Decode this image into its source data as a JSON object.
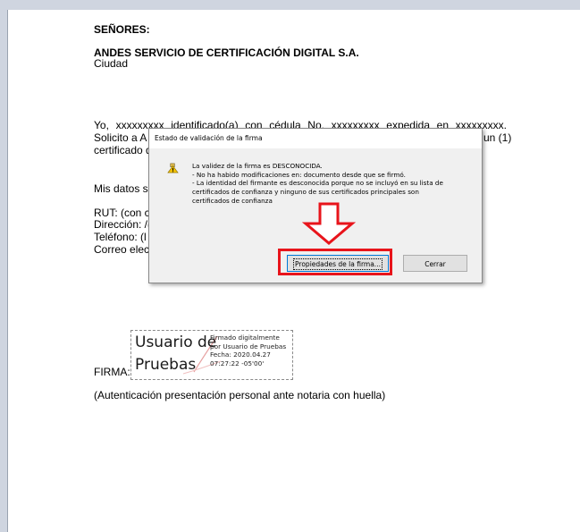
{
  "document": {
    "heading": "SEÑORES:",
    "company": "ANDES SERVICIO DE CERTIFICACIÓN DIGITAL S.A.",
    "city": "Ciudad",
    "p1_line1": "Yo, xxxxxxxxx identificado(a) con cédula No. xxxxxxxxx expedida en xxxxxxxxx.",
    "p1_line2_start": "Solicito a A",
    "p1_line2_end": "un (1)",
    "p1_line3_start": "certificado d",
    "datos_start": "Mis datos s",
    "rut_start": "RUT: (con c",
    "direccion_start": "Dirección: /(",
    "telefono_start": "Teléfono: (l",
    "correo_start": "Correo elec",
    "firma_label": "FIRMA:",
    "autenticacion": "(Autenticación presentación personal ante notaria con huella)"
  },
  "signature": {
    "name_line1": "Usuario de",
    "name_line2": "Pruebas",
    "info": [
      "Firmado digitalmente",
      "por Usuario de Pruebas",
      "Fecha: 2020.04.27",
      "07:27:22 -05'00'"
    ]
  },
  "dialog": {
    "title": "Estado de validación de la firma",
    "icon": "warning-icon",
    "lines": [
      "La validez de la firma es DESCONOCIDA.",
      "- No ha habido modificaciones en: documento desde que se firmó.",
      "- La identidad del firmante es desconocida porque no se incluyó en su lista de",
      "certificados de confianza y ninguno de sus certificados principales son",
      "certificados de confianza"
    ],
    "properties_button": "Propiedades de la firma...",
    "close_button": "Cerrar"
  },
  "colors": {
    "highlight": "#e8141b",
    "chrome": "#cfd5e0"
  }
}
